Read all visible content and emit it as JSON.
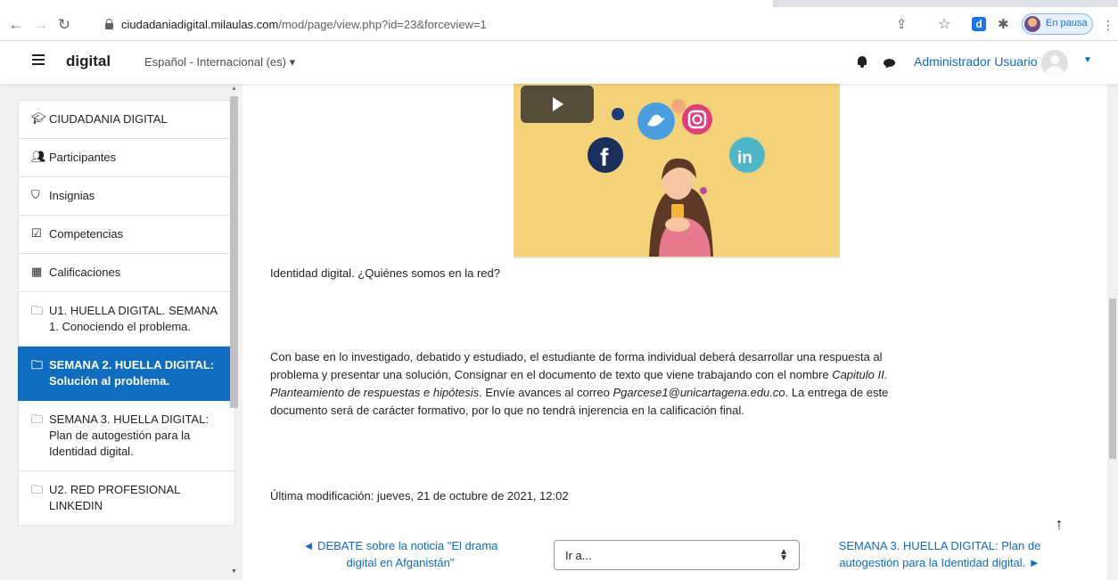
{
  "browser": {
    "url_host": "ciudadaniadigital.milaulas.com",
    "url_path": "/mod/page/view.php?id=23&forceview=1",
    "profile_label": "En pausa"
  },
  "navbar": {
    "site_name": "digital",
    "language": "Español - Internacional (es) ▾",
    "user_name": "Administrador Usuario"
  },
  "drawer": {
    "items": [
      {
        "label": "CIUDADANIA DIGITAL",
        "icon": "graduation-cap-icon"
      },
      {
        "label": "Participantes",
        "icon": "users-icon"
      },
      {
        "label": "Insignias",
        "icon": "shield-icon"
      },
      {
        "label": "Competencias",
        "icon": "checkbox-icon"
      },
      {
        "label": "Calificaciones",
        "icon": "table-icon"
      },
      {
        "label": "U1. HUELLA DIGITAL. SEMANA 1. Conociendo el problema.",
        "icon": "folder-icon"
      },
      {
        "label": "SEMANA 2. HUELLA DIGITAL: Solución al problema.",
        "icon": "folder-icon",
        "active": true
      },
      {
        "label": "SEMANA 3. HUELLA DIGITAL: Plan de autogestión para la Identidad digital.",
        "icon": "folder-icon"
      },
      {
        "label": "U2. RED PROFESIONAL LINKEDIN",
        "icon": "folder-icon"
      }
    ]
  },
  "main": {
    "caption": "Identidad digital. ¿Quiénes somos en la red?",
    "body_part1": "Con base en lo investigado, debatido y estudiado, el estudiante de forma individual deberá desarrollar una respuesta al problema y presentar una solución, Consignar en el documento de texto que viene trabajando con el nombre ",
    "body_em1": "Capitulo II. Planteamiento de respuestas e hipótesis",
    "body_part2": ". Envíe avances al correo ",
    "body_em2": "Pgarcese1@unicartagena.edu.co",
    "body_part3": ". La entrega de este documento será de carácter formativo, por lo que no tendrá injerencia en la calificación final.",
    "last_modified": "Última modificación: jueves, 21 de octubre de 2021, 12:02",
    "prev_link": "◄ DEBATE sobre la noticia \"El drama digital en Afganistán\"",
    "jump_placeholder": "Ir a...",
    "next_link": "SEMANA 3. HUELLA DIGITAL: Plan de autogestión para la Identidad digital. ►"
  },
  "colors": {
    "accent": "#0f6cbf",
    "video_bg": "#f3d27a",
    "drawer_bg": "#f2f2f2"
  }
}
